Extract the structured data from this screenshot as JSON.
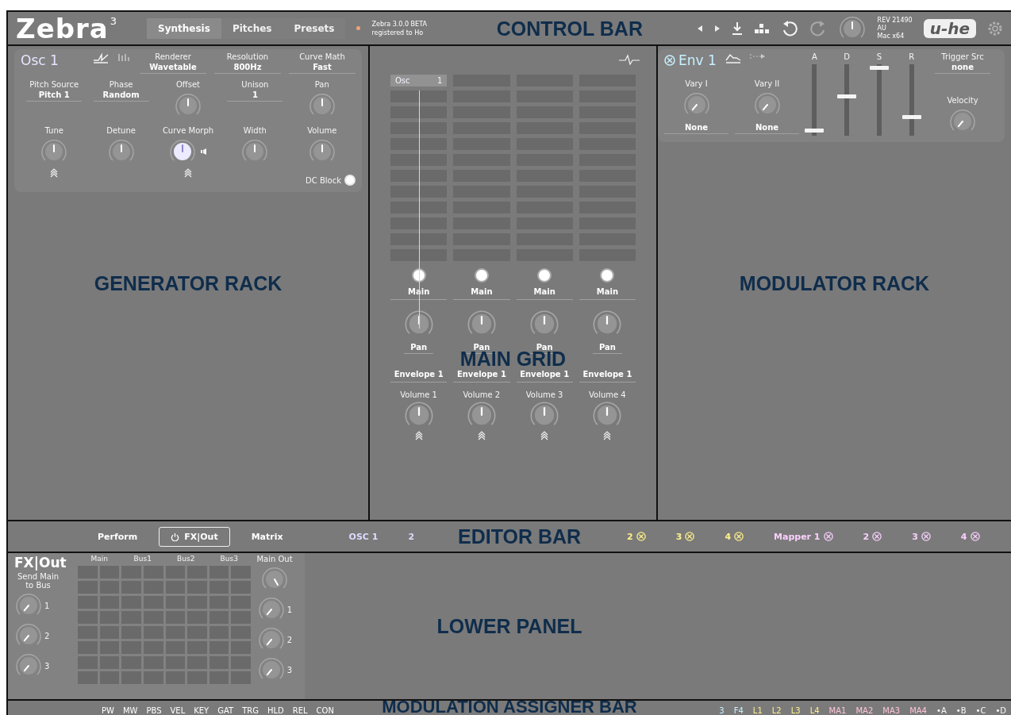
{
  "control_bar": {
    "logo": "Zebra",
    "logo_version": "3",
    "tabs": [
      {
        "label": "Synthesis",
        "selected": true
      },
      {
        "label": "Pitches",
        "selected": false
      },
      {
        "label": "Presets",
        "selected": false
      }
    ],
    "info_lines": [
      "Zebra 3.0.0 BETA",
      "registered to Ho"
    ],
    "build_lines": [
      "REV 21490",
      "AU",
      "Mac x64"
    ],
    "brand": "u-he",
    "region_label": "CONTROL BAR"
  },
  "generator_rack": {
    "region_label": "GENERATOR RACK",
    "title": "Osc 1",
    "header_selectors": [
      {
        "label": "Renderer",
        "value": "Wavetable"
      },
      {
        "label": "Resolution",
        "value": "800Hz"
      },
      {
        "label": "Curve Math",
        "value": "Fast"
      }
    ],
    "rows": [
      [
        {
          "kind": "selector",
          "label": "Pitch Source",
          "value": "Pitch 1"
        },
        {
          "kind": "selector",
          "label": "Phase",
          "value": "Random"
        },
        {
          "kind": "knob",
          "label": "Offset",
          "modulated": false,
          "active": false
        },
        {
          "kind": "selector",
          "label": "Unison",
          "value": "1"
        },
        {
          "kind": "knob",
          "label": "Pan",
          "modulated": false,
          "active": false
        }
      ],
      [
        {
          "kind": "knob",
          "label": "Tune",
          "modulated": true,
          "active": false
        },
        {
          "kind": "knob",
          "label": "Detune",
          "modulated": false,
          "active": false
        },
        {
          "kind": "knob",
          "label": "Curve Morph",
          "modulated": true,
          "active": true
        },
        {
          "kind": "knob",
          "label": "Width",
          "modulated": false,
          "active": false
        },
        {
          "kind": "knob",
          "label": "Volume",
          "modulated": false,
          "active": false
        }
      ]
    ],
    "dc_block": {
      "label": "DC Block",
      "on": true
    }
  },
  "main_grid": {
    "region_label": "MAIN GRID",
    "columns": [
      {
        "module": {
          "name": "Osc",
          "number": "1"
        },
        "output": "Main",
        "pan_label": "Pan",
        "envelope": "Envelope 1",
        "volume_label": "Volume 1"
      },
      {
        "output": "Main",
        "pan_label": "Pan",
        "envelope": "Envelope 1",
        "volume_label": "Volume 2"
      },
      {
        "output": "Main",
        "pan_label": "Pan",
        "envelope": "Envelope 1",
        "volume_label": "Volume 3"
      },
      {
        "output": "Main",
        "pan_label": "Pan",
        "envelope": "Envelope 1",
        "volume_label": "Volume 4"
      }
    ]
  },
  "modulator_rack": {
    "region_label": "MODULATOR RACK",
    "title": "Env 1",
    "stages": [
      {
        "label": "A",
        "level": 0.05
      },
      {
        "label": "D",
        "level": 0.55
      },
      {
        "label": "S",
        "level": 0.98
      },
      {
        "label": "R",
        "level": 0.25
      }
    ],
    "vary": [
      {
        "label": "Vary I",
        "source": "None"
      },
      {
        "label": "Vary II",
        "source": "None"
      }
    ],
    "trigger": {
      "label": "Trigger Src",
      "value": "none"
    },
    "velocity_label": "Velocity"
  },
  "editor_bar": {
    "region_label": "EDITOR BAR",
    "tabs": [
      {
        "label": "Perform",
        "selected": false,
        "power": false
      },
      {
        "label": "FX|Out",
        "selected": true,
        "power": true
      },
      {
        "label": "Matrix",
        "selected": false,
        "power": false
      }
    ],
    "slots": [
      {
        "label": "OSC 1",
        "color": "#dcdaff",
        "target": false
      },
      {
        "label": "2",
        "color": "#dcdaff",
        "target": false
      },
      {
        "label": "2",
        "color": "#fff08a",
        "target": true
      },
      {
        "label": "3",
        "color": "#fff08a",
        "target": true
      },
      {
        "label": "4",
        "color": "#fff08a",
        "target": true
      },
      {
        "label": "Mapper 1",
        "color": "#fbd0ff",
        "target": true
      },
      {
        "label": "2",
        "color": "#fbd0ff",
        "target": true
      },
      {
        "label": "3",
        "color": "#fbd0ff",
        "target": true
      },
      {
        "label": "4",
        "color": "#fbd0ff",
        "target": true
      }
    ]
  },
  "lower_panel": {
    "region_label": "LOWER PANEL",
    "title": "FX|Out",
    "send_label": "Send Main to Bus",
    "sends": [
      "1",
      "2",
      "3"
    ],
    "bus_headers": [
      "Main",
      "Bus1",
      "Bus2",
      "Bus3"
    ],
    "out_header": "Main Out",
    "outs": [
      "1",
      "2",
      "3"
    ]
  },
  "mod_assigner_bar": {
    "region_label": "MODULATION ASSIGNER BAR",
    "left": [
      {
        "label": "PW",
        "color": "#ffffff"
      },
      {
        "label": "MW",
        "color": "#ffffff"
      },
      {
        "label": "PBS",
        "color": "#ffffff"
      },
      {
        "label": "VEL",
        "color": "#ffffff"
      },
      {
        "label": "KEY",
        "color": "#ffffff"
      },
      {
        "label": "GAT",
        "color": "#ffffff"
      },
      {
        "label": "TRG",
        "color": "#ffffff"
      },
      {
        "label": "HLD",
        "color": "#ffffff"
      },
      {
        "label": "REL",
        "color": "#ffffff"
      },
      {
        "label": "CON",
        "color": "#ffffff"
      }
    ],
    "right": [
      {
        "label": "3",
        "color": "#c4f2ff"
      },
      {
        "label": "F4",
        "color": "#c4f2ff"
      },
      {
        "label": "L1",
        "color": "#fff08a"
      },
      {
        "label": "L2",
        "color": "#fff08a"
      },
      {
        "label": "L3",
        "color": "#fff08a"
      },
      {
        "label": "L4",
        "color": "#fff08a"
      },
      {
        "label": "MA1",
        "color": "#ffc4d6"
      },
      {
        "label": "MA2",
        "color": "#ffc4d6"
      },
      {
        "label": "MA3",
        "color": "#ffc4d6"
      },
      {
        "label": "MA4",
        "color": "#ffc4d6"
      },
      {
        "label": "•A",
        "color": "#fafafa"
      },
      {
        "label": "•B",
        "color": "#fafafa"
      },
      {
        "label": "•C",
        "color": "#fafafa"
      },
      {
        "label": "•D",
        "color": "#fafafa"
      }
    ]
  }
}
